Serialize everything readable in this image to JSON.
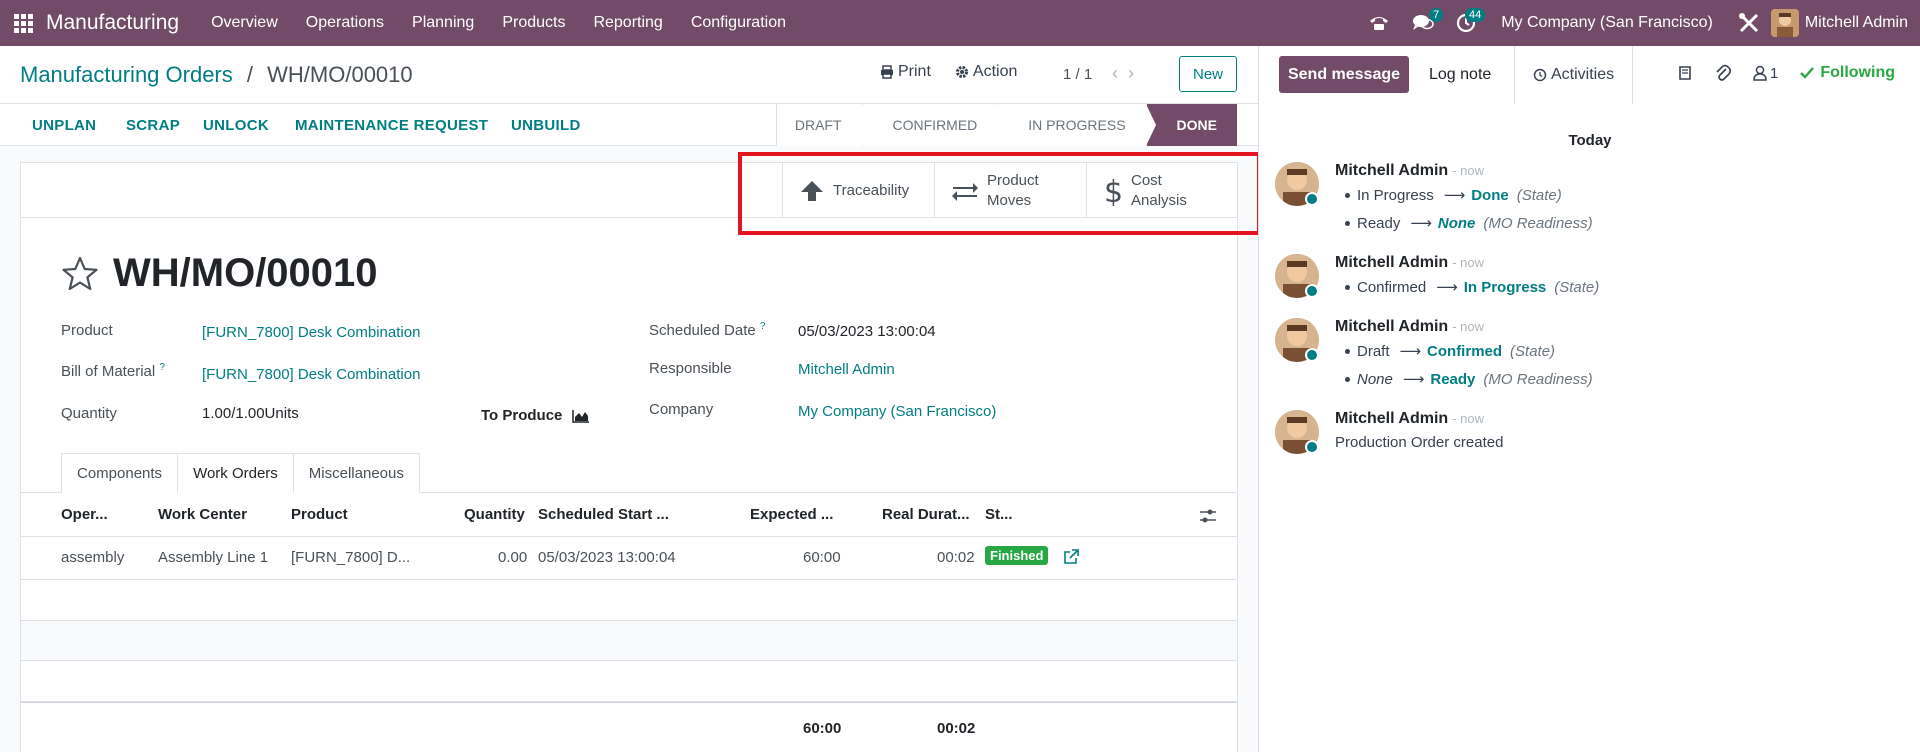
{
  "navbar": {
    "app_name": "Manufacturing",
    "menu": [
      "Overview",
      "Operations",
      "Planning",
      "Products",
      "Reporting",
      "Configuration"
    ],
    "messages_count": "7",
    "activities_count": "44",
    "company": "My Company (San Francisco)",
    "user": "Mitchell Admin"
  },
  "control": {
    "breadcrumb_parent": "Manufacturing Orders",
    "breadcrumb_sep": "/",
    "breadcrumb_current": "WH/MO/00010",
    "print_label": "Print",
    "action_label": "Action",
    "pager": "1 / 1",
    "new_label": "New"
  },
  "statusbar": {
    "buttons": [
      "UNPLAN",
      "SCRAP",
      "UNLOCK",
      "MAINTENANCE REQUEST",
      "UNBUILD"
    ],
    "steps": [
      "DRAFT",
      "CONFIRMED",
      "IN PROGRESS",
      "DONE"
    ],
    "active_step": "DONE"
  },
  "smart_buttons": {
    "traceability": "Traceability",
    "product_moves_1": "Product",
    "product_moves_2": "Moves",
    "cost_analysis_1": "Cost",
    "cost_analysis_2": "Analysis"
  },
  "form": {
    "title": "WH/MO/00010",
    "product_label": "Product",
    "product_value": "[FURN_7800] Desk Combination",
    "bom_label": "Bill of Material",
    "bom_help": "?",
    "bom_value": "[FURN_7800] Desk Combination",
    "quantity_label": "Quantity",
    "quantity_value": "1.00/1.00Units",
    "to_produce_label": "To Produce",
    "scheduled_label": "Scheduled Date",
    "scheduled_help": "?",
    "scheduled_value": "05/03/2023 13:00:04",
    "responsible_label": "Responsible",
    "responsible_value": "Mitchell Admin",
    "company_label": "Company",
    "company_value": "My Company (San Francisco)"
  },
  "tabs": [
    "Components",
    "Work Orders",
    "Miscellaneous"
  ],
  "active_tab": "Work Orders",
  "table": {
    "headers": [
      "Oper...",
      "Work Center",
      "Product",
      "Quantity",
      "Scheduled Start ...",
      "Expected ...",
      "Real Durat...",
      "St..."
    ],
    "rows": [
      [
        "assembly",
        "Assembly Line 1",
        "[FURN_7800] D...",
        "0.00",
        "05/03/2023 13:00:04",
        "60:00",
        "00:02",
        "Finished"
      ]
    ],
    "totals": {
      "expected": "60:00",
      "real": "00:02"
    }
  },
  "chatter": {
    "send_message": "Send message",
    "log_note": "Log note",
    "activities": "Activities",
    "followers_count": "1",
    "following": "Following",
    "today": "Today",
    "messages": [
      {
        "author": "Mitchell Admin",
        "time": "- now",
        "changes": [
          {
            "old": "In Progress",
            "new": "Done",
            "field": "(State)"
          },
          {
            "old": "Ready",
            "new": "None",
            "field": "(MO Readiness)"
          }
        ]
      },
      {
        "author": "Mitchell Admin",
        "time": "- now",
        "changes": [
          {
            "old": "Confirmed",
            "new": "In Progress",
            "field": "(State)"
          }
        ]
      },
      {
        "author": "Mitchell Admin",
        "time": "- now",
        "changes": [
          {
            "old": "Draft",
            "new": "Confirmed",
            "field": "(State)"
          },
          {
            "old": "None",
            "new": "Ready",
            "field": "(MO Readiness)"
          }
        ]
      },
      {
        "author": "Mitchell Admin",
        "time": "- now",
        "body": "Production Order created"
      }
    ]
  },
  "colors": {
    "brand": "#714b67",
    "link": "#017e84",
    "success": "#28a745",
    "highlight": "#e3141f"
  }
}
